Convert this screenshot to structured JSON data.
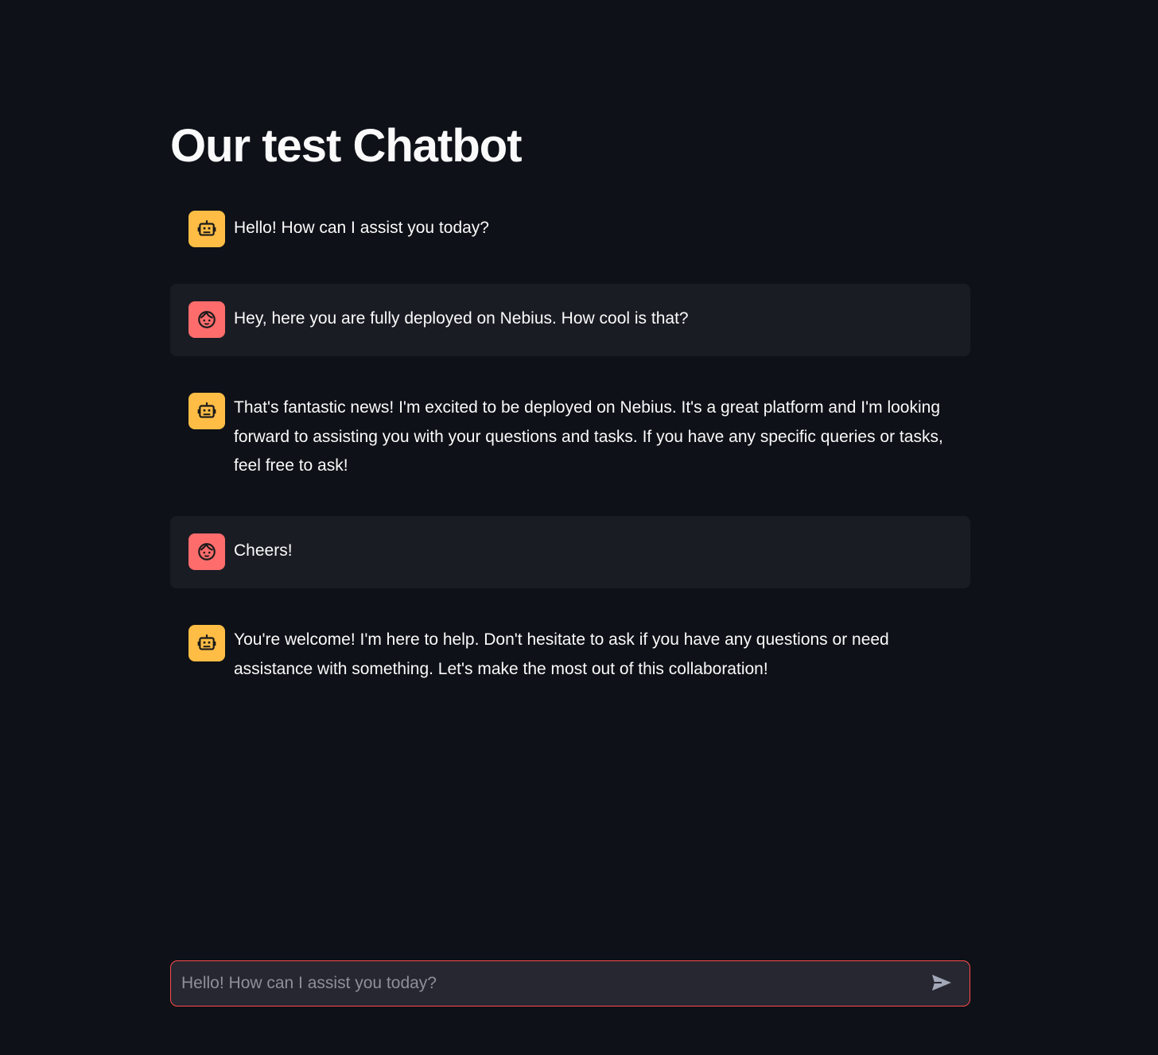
{
  "page": {
    "title": "Our test Chatbot"
  },
  "colors": {
    "background": "#0e1117",
    "user_message_bg": "#1a1c24",
    "assistant_avatar": "#ffbd45",
    "user_avatar": "#ff6c6c",
    "input_border": "#ff4b4b",
    "input_bg": "#262730"
  },
  "messages": [
    {
      "role": "assistant",
      "avatar_icon": "robot-icon",
      "text": "Hello! How can I assist you today?"
    },
    {
      "role": "user",
      "avatar_icon": "user-face-icon",
      "text": "Hey, here you are fully deployed on Nebius. How cool is that?"
    },
    {
      "role": "assistant",
      "avatar_icon": "robot-icon",
      "text": "That's fantastic news! I'm excited to be deployed on Nebius. It's a great platform and I'm looking forward to assisting you with your questions and tasks. If you have any specific queries or tasks, feel free to ask!"
    },
    {
      "role": "user",
      "avatar_icon": "user-face-icon",
      "text": "Cheers!"
    },
    {
      "role": "assistant",
      "avatar_icon": "robot-icon",
      "text": "You're welcome! I'm here to help. Don't hesitate to ask if you have any questions or need assistance with something. Let's make the most out of this collaboration!"
    }
  ],
  "chat_input": {
    "value": "",
    "placeholder": "Hello! How can I assist you today?",
    "send_icon": "send-icon"
  }
}
